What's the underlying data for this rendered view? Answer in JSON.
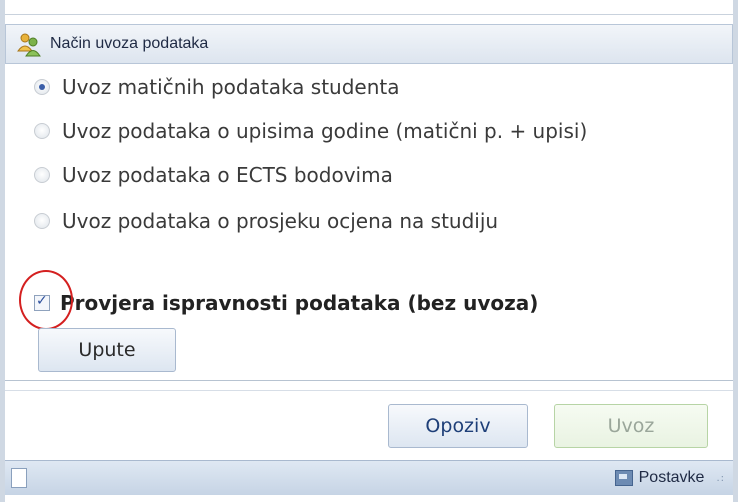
{
  "group": {
    "title": "Način uvoza podataka",
    "icon": "people-icon"
  },
  "options": [
    {
      "label": "Uvoz matičnih podataka studenta",
      "checked": true
    },
    {
      "label": "Uvoz podataka o upisima godine (matični p. + upisi)",
      "checked": false
    },
    {
      "label": "Uvoz podataka o ECTS bodovima",
      "checked": false
    },
    {
      "label": "Uvoz podataka o prosjeku ocjena na studiju",
      "checked": false
    }
  ],
  "validation": {
    "label": "Provjera ispravnosti podataka (bez uvoza)",
    "checked": true
  },
  "buttons": {
    "upute": "Upute",
    "opoziv": "Opoziv",
    "uvoz": "Uvoz"
  },
  "status_bar": {
    "settings_label": "Postavke"
  },
  "colors": {
    "annotation": "#d42020",
    "accent": "#3a5ea8"
  }
}
